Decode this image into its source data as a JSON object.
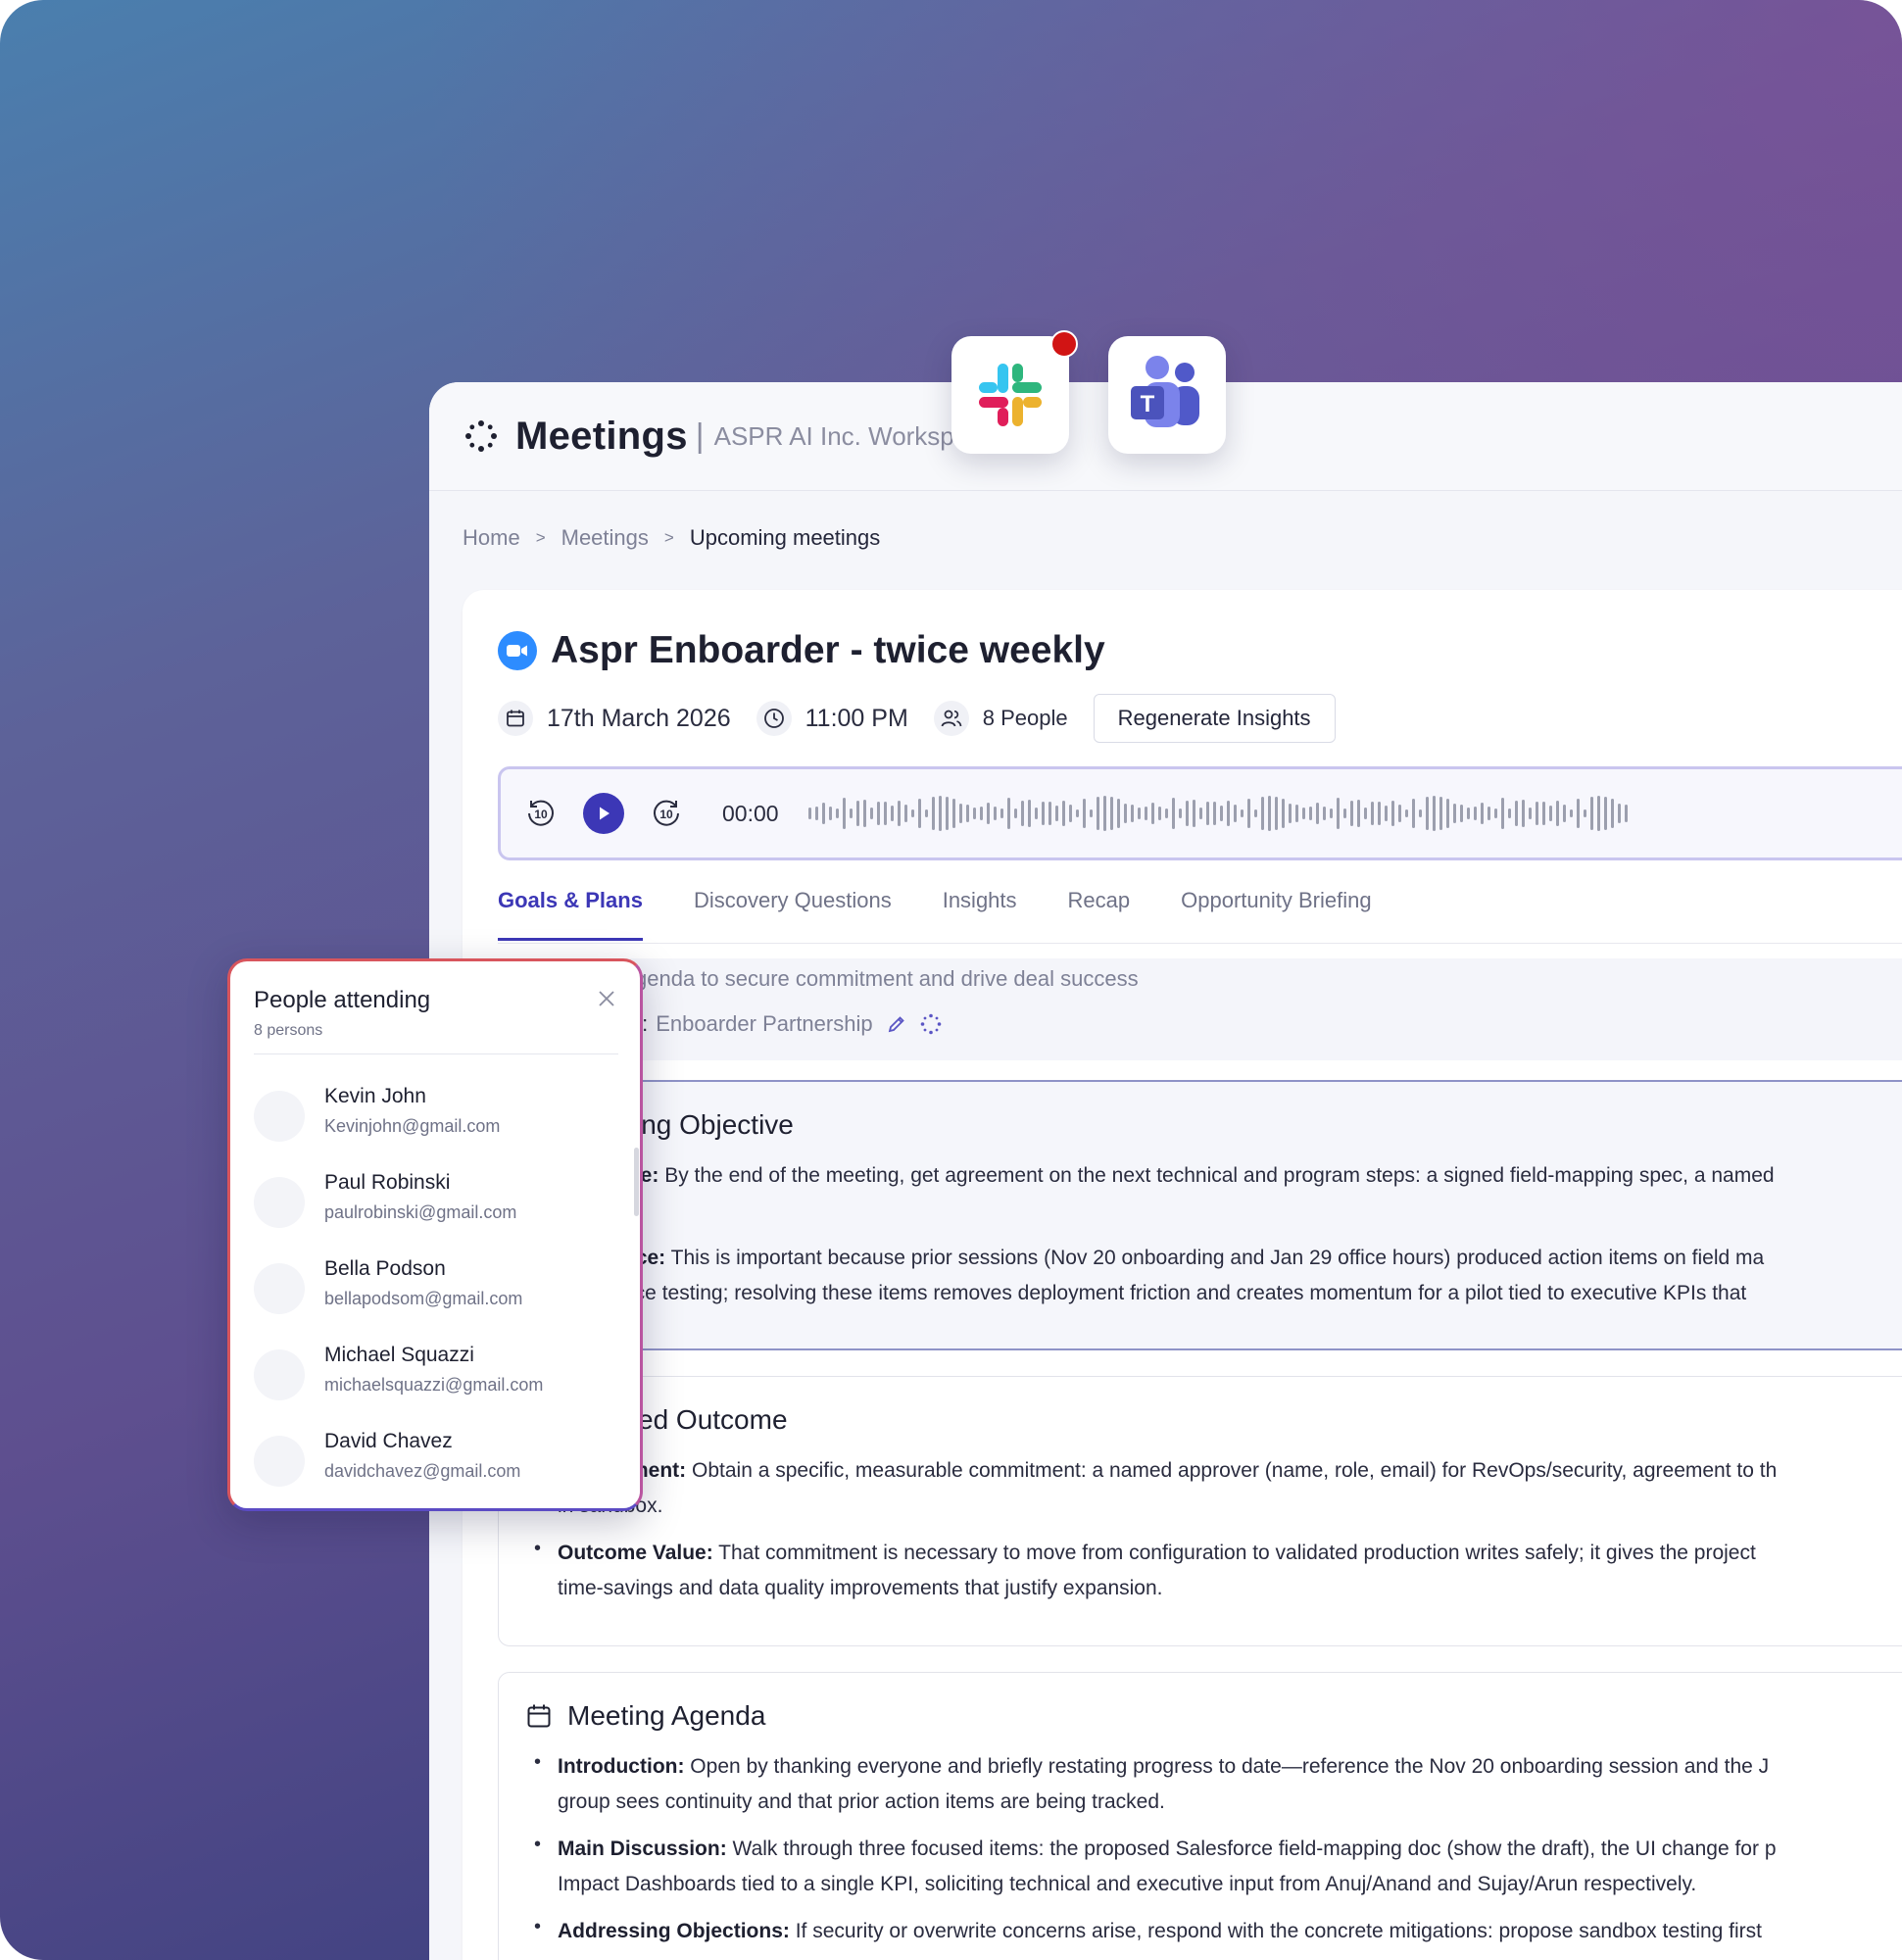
{
  "app": {
    "title": "Meetings",
    "separator": "|",
    "workspace": "ASPR AI Inc. Workspac"
  },
  "integrations": [
    "slack-icon",
    "microsoft-teams-icon"
  ],
  "breadcrumb": {
    "items": [
      "Home",
      "Meetings",
      "Upcoming meetings"
    ],
    "separator": ">"
  },
  "meeting": {
    "title": "Aspr Enboarder - twice weekly",
    "date": "17th March 2026",
    "time": "11:00 PM",
    "people": "8 People",
    "regenerate_label": "Regenerate Insights"
  },
  "player": {
    "time": "00:00",
    "rewind_label": "10",
    "forward_label": "10"
  },
  "tabs": [
    {
      "label": "Goals & Plans",
      "active": true
    },
    {
      "label": "Discovery Questions",
      "active": false
    },
    {
      "label": "Insights",
      "active": false
    },
    {
      "label": "Recap",
      "active": false
    },
    {
      "label": "Opportunity Briefing",
      "active": false
    }
  ],
  "subject": {
    "line1": "genda to secure commitment and drive deal success",
    "opportunity_label": "ty:",
    "opportunity_value": "Enboarder Partnership"
  },
  "sections": {
    "objective": {
      "title": "ing Objective",
      "p1_label": "ve:",
      "p1_text": " By the end of the meeting, get agreement on the next technical and program steps: a signed field-mapping spec, a named",
      "p2_label": "nce:",
      "p2_text": " This is important because prior sessions (Nov 20 onboarding and Jan 29 office hours) produced action items on field ma",
      "p2_cont": "nce testing; resolving these items removes deployment friction and creates momentum for a pilot tied to executive KPIs that"
    },
    "outcome": {
      "title": "ed Outcome",
      "p1_label": "ment:",
      "p1_text": " Obtain a specific, measurable commitment: a named approver (name, role, email) for RevOps/security, agreement to th",
      "p1_cont": "in sandbox.",
      "p2_label": "Outcome Value:",
      "p2_text": " That commitment is necessary to move from configuration to validated production writes safely; it gives the project",
      "p2_cont": "time-savings and data quality improvements that justify expansion."
    },
    "agenda": {
      "title": "Meeting Agenda",
      "items": [
        {
          "label": "Introduction:",
          "text": " Open by thanking everyone and briefly restating progress to date—reference the Nov 20 onboarding session and the J",
          "cont": "group sees continuity and that prior action items are being tracked."
        },
        {
          "label": "Main Discussion:",
          "text": " Walk through three focused items: the proposed Salesforce field-mapping doc (show the draft), the UI change for p",
          "cont": "Impact Dashboards tied to a single KPI, soliciting technical and executive input from Anuj/Anand and Sujay/Arun respectively."
        },
        {
          "label": "Addressing Objections:",
          "text": " If security or overwrite concerns arise, respond with the concrete mitigations: propose sandbox testing first",
          "cont": ""
        }
      ]
    }
  },
  "attendees": {
    "title": "People attending",
    "count": "8 persons",
    "people": [
      {
        "name": "Kevin John",
        "email": "Kevinjohn@gmail.com"
      },
      {
        "name": "Paul Robinski",
        "email": "paulrobinski@gmail.com"
      },
      {
        "name": "Bella Podson",
        "email": "bellapodsom@gmail.com"
      },
      {
        "name": "Michael Squazzi",
        "email": "michaelsquazzi@gmail.com"
      },
      {
        "name": "David Chavez",
        "email": "davidchavez@gmail.com"
      }
    ]
  },
  "colors": {
    "accent": "#3c37b6",
    "zoom_blue": "#2d8cff",
    "notification_red": "#d11414"
  }
}
